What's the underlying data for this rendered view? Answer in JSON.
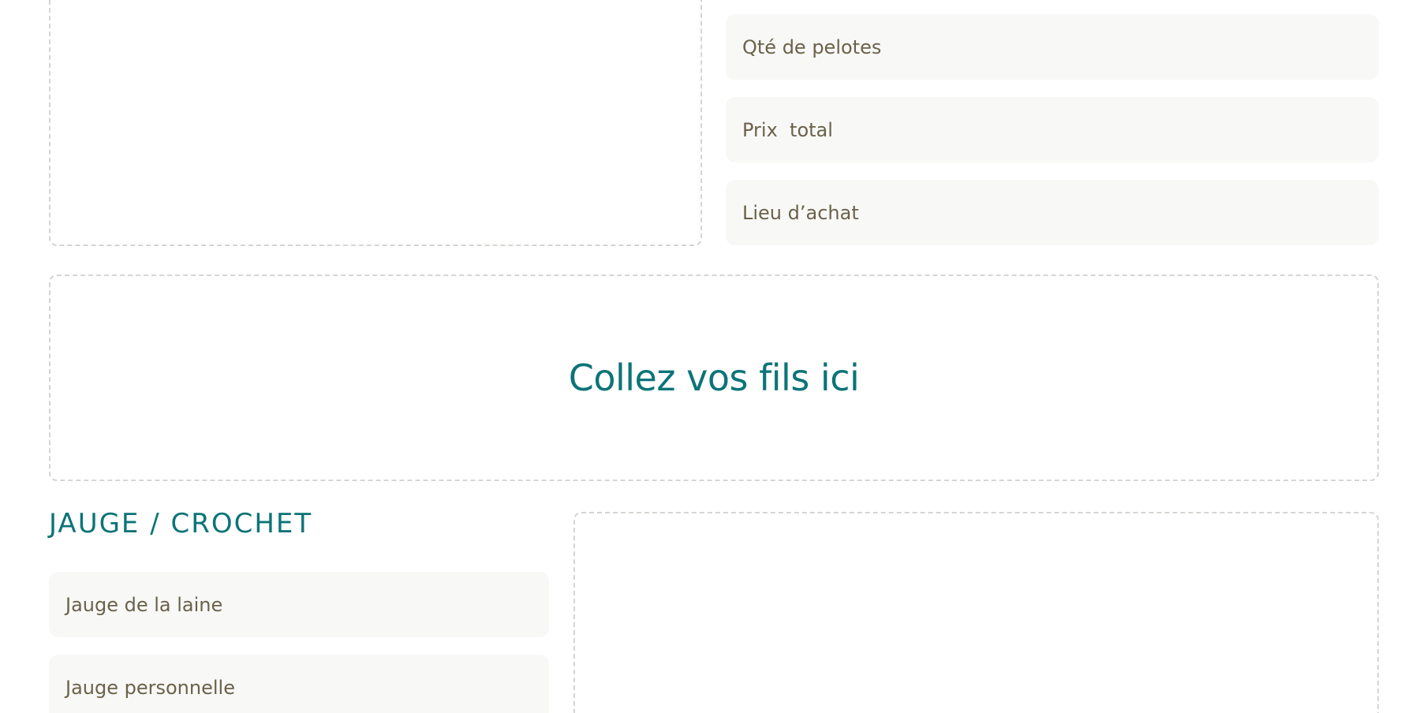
{
  "purchase": {
    "fields": {
      "quantity_placeholder": "Qté de pelotes",
      "total_price_placeholder": "Prix  total",
      "place_placeholder": "Lieu d’achat"
    },
    "photo_icon": "camera-icon"
  },
  "yarn_samples": {
    "paste_label": "Collez vos fils ici"
  },
  "gauge": {
    "section_title": "JAUGE / CROCHET",
    "fields": {
      "yarn_gauge_placeholder": "Jauge de la laine",
      "personal_gauge_placeholder": "Jauge personnelle"
    }
  },
  "colors": {
    "accent": "#0c7478",
    "field_background": "#f8f8f7",
    "field_text": "#6a6249",
    "dashed_border": "#d5d5d2",
    "icon_tint": "#c5e6da"
  }
}
